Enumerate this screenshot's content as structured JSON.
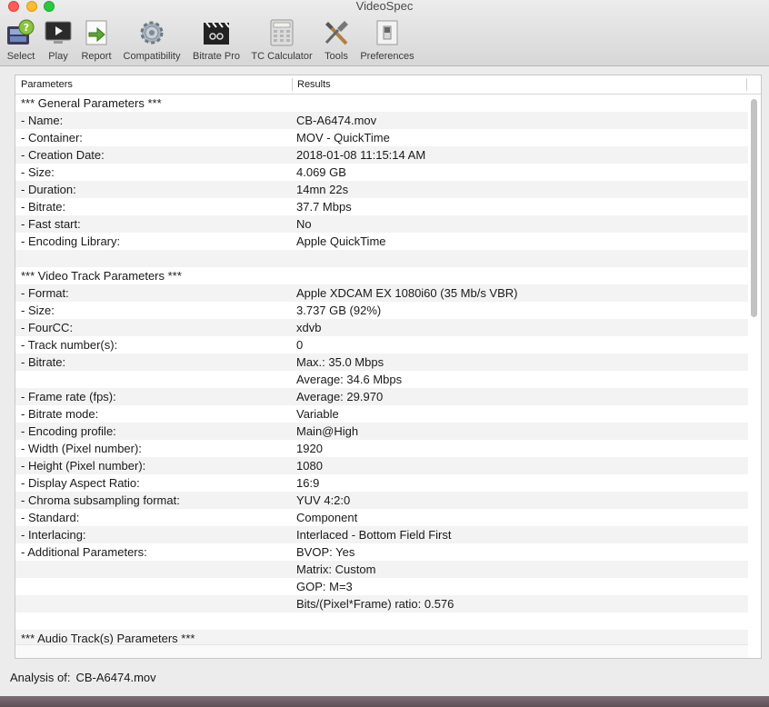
{
  "window": {
    "title": "VideoSpec"
  },
  "toolbar": {
    "select": "Select",
    "play": "Play",
    "report": "Report",
    "compatibility": "Compatibility",
    "bitrate_pro": "Bitrate Pro",
    "tc_calculator": "TC Calculator",
    "tools": "Tools",
    "preferences": "Preferences"
  },
  "table": {
    "columns": [
      "Parameters",
      "Results"
    ],
    "rows": [
      [
        "*** General Parameters ***",
        ""
      ],
      [
        "- Name:",
        "CB-A6474.mov"
      ],
      [
        "- Container:",
        "MOV - QuickTime"
      ],
      [
        "- Creation Date:",
        "2018-01-08 11:15:14 AM"
      ],
      [
        "- Size:",
        "4.069 GB"
      ],
      [
        "- Duration:",
        "14mn 22s"
      ],
      [
        "- Bitrate:",
        "37.7 Mbps"
      ],
      [
        "- Fast start:",
        "No"
      ],
      [
        "- Encoding Library:",
        "Apple QuickTime"
      ],
      [
        "",
        ""
      ],
      [
        "*** Video Track Parameters ***",
        ""
      ],
      [
        "- Format:",
        "Apple XDCAM EX 1080i60 (35 Mb/s VBR)"
      ],
      [
        "- Size:",
        "3.737 GB (92%)"
      ],
      [
        "- FourCC:",
        "xdvb"
      ],
      [
        "- Track number(s):",
        "0"
      ],
      [
        "- Bitrate:",
        "Max.: 35.0 Mbps"
      ],
      [
        "",
        "Average: 34.6 Mbps"
      ],
      [
        "- Frame rate (fps):",
        "Average: 29.970"
      ],
      [
        "- Bitrate mode:",
        "Variable"
      ],
      [
        "- Encoding profile:",
        "Main@High"
      ],
      [
        "- Width (Pixel number):",
        "1920"
      ],
      [
        "- Height (Pixel number):",
        "1080"
      ],
      [
        "- Display Aspect Ratio:",
        "16:9"
      ],
      [
        "- Chroma subsampling format:",
        "YUV 4:2:0"
      ],
      [
        "- Standard:",
        "Component"
      ],
      [
        "- Interlacing:",
        "Interlaced - Bottom Field First"
      ],
      [
        "- Additional Parameters:",
        "BVOP: Yes"
      ],
      [
        "",
        "Matrix: Custom"
      ],
      [
        "",
        "GOP: M=3"
      ],
      [
        "",
        "Bits/(Pixel*Frame) ratio: 0.576"
      ],
      [
        "",
        ""
      ],
      [
        "*** Audio Track(s) Parameters ***",
        ""
      ]
    ]
  },
  "status": {
    "label": "Analysis of:",
    "filename": "CB-A6474.mov"
  }
}
